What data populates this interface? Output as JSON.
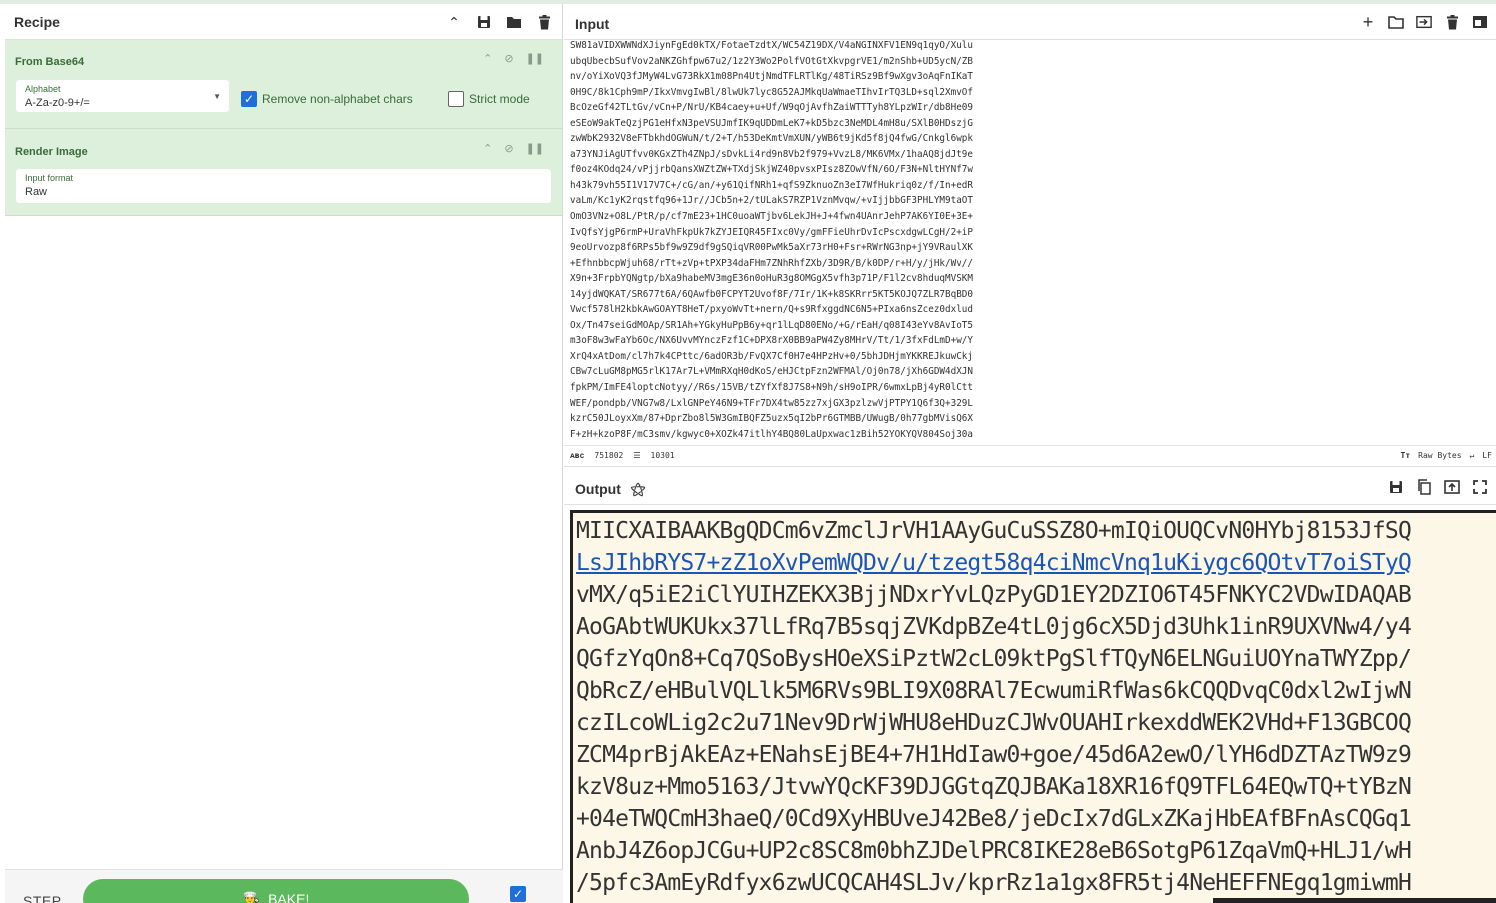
{
  "recipe": {
    "title": "Recipe",
    "ops": [
      {
        "name": "From Base64",
        "alphabet_label": "Alphabet",
        "alphabet_value": "A-Za-z0-9+/=",
        "remove_nonalpha_label": "Remove non-alphabet chars",
        "remove_nonalpha_checked": true,
        "strict_label": "Strict mode",
        "strict_checked": false
      },
      {
        "name": "Render Image",
        "input_format_label": "Input format",
        "input_format_value": "Raw"
      }
    ],
    "footer": {
      "step_label": "STEP",
      "bake_label": "BAKE!",
      "auto_bake_checked": true
    }
  },
  "input": {
    "title": "Input",
    "lines": [
      "SW81aVIDXWWNdXJiynFgEd0kTX/FotaeTzdtX/WC54Z19DX/V4aNGINXFV1EN9q1qyO/Xulu",
      "ubqUbecbSufVov2aNKZGhfpw67u2/1z2Y3Wo2PolfVOtGtXkvpgrVE1/m2nShb+UD5ycN/ZB",
      "nv/oYiXoVQ3fJMyW4LvG73RkX1m08Pn4UtjNmdTFLRTlKg/48TiRSz9Bf9wXgv3oAqFnIKaT",
      "0H9C/8k1Cph9mP/IkxVmvgIwBl/8lwUk7lyc8G52AJMkqUaWmaeTIhvIrTQ3LD+sql2XmvOf",
      "BcOzeGf42TLtGv/vCn+P/NrU/KB4caey+u+Uf/W9qOjAvfhZaiWTTTyh8YLpzWIr/db8He09",
      "eSEoW9akTeQzjPG1eHfxN3peVSUJmfIK9qUDDmLeK7+kD5bzc3NeMDL4mH8u/SXlB0HDszjG",
      "zwWbK2932V8eFTbkhdOGWuN/t/2+T/h53DeKmtVmXUN/yWB6t9jKd5f8jQ4fwG/Cnkgl6wpk",
      "a73YNJiAgUTfvv0KGxZTh4ZNpJ/sDvkLi4rd9n8Vb2f979+VvzL8/MK6VMx/1haAQ8jdJt9e",
      "f0oz4KOdq24/vPjjrbQansXWZtZW+TXdjSkjWZ40pvsxPIsz8ZOwVfN/6O/F3N+NltHYNf7w",
      "h43k79vh55I1V17V7C+/cG/an/+y61QifNRh1+qfS9ZknuoZn3eI7WfHukriq0z/f/In+edR",
      "vaLm/Kc1yK2rqstfq96+1Jr//JCb5n+2/tULakS7RZP1VznMvqw/+vIjjbbGF3PHLYM9taOT",
      "OmO3VNz+O8L/PtR/p/cf7mE23+1HC0uoaWTjbv6LekJH+J+4fwn4UAnrJehP7AK6YI0E+3E+",
      "IvQfsYjgP6rmP+UraVhFkpUk7kZYJEIQR45FIxc0Vy/gmFFieUhrDvIcPscxdgwLCgH/2+iP",
      "9eoUrvozp8f6RPs5bf9w9Z9df9gSQiqVR00PwMk5aXr73rH0+Fsr+RWrNG3np+jY9VRaulXK",
      "+EfhnbbcpWjuh68/rTt+zVp+tPXP34daFHm7ZNhRhfZXb/3D9R/B/k0DP/r+H/y/jHk/Wv//",
      "X9n+3FrpbYQNgtp/bXa9habeMV3mgE36n0oHuR3g8OMGgX5vfh3p71P/F1l2cv8hduqMVSKM",
      "14yjdWQKAT/SR677t6A/6QAwfb0FCPYT2Uvof8F/7Ir/1K+k8SKRrr5KT5KOJQ7ZLR7BqBD0",
      "Vwcf578lH2kbkAwGOAYT8HeT/pxyoWvTt+nern/Q+s9RfxggdNC6N5+PIxa6nsZcez0dxlud",
      "Ox/Tn47seiGdMOAp/SR1Ah+YGkyHuPpB6y+qr1lLqD80ENo/+G/rEaH/q08I43eYv8AvIoT5",
      "m3oF8w3wFaYb6Oc/NX6UvvMYnczFzf1C+DPX8rX0BB9aPW4Zy8MHrV/Tt/1/3fxFdLmD+w/Y",
      "XrQ4xAtDom/cl7h7k4CPttc/6adOR3b/FvQX7Cf0H7e4HPzHv+0/5bhJDHjmYKKREJkuwCkj",
      "CBw7cLuGM8pMG5rlK17Ar7L+VMmRXqH0dKoS/eHJCtpFzn2WFMAl/Oj0n78/jXh6GDW4dXJN",
      "fpkPM/ImFE4loptcNotyy//R6s/15VB/tZYfXf8J7S8+N9h/sH9oIPR/6wmxLpBj4yR0lCtt",
      "WEF/pondpb/VNG7w8/LxlGNPeY46N9+TFr7DX4tw85zz7xjGX3pzlzwVjPTPY1Q6f3Q+329L",
      "kzrC50JLoyxXm/87+DprZbo8l5W3GmIBQFZ5uzx5qI2bPr6GTMBB/UWugB/0h77gbMVisQ6X",
      "F+zH+kzoP8F/mC3smv/kgwyc0+XOZk47itlhY4BQ80LaUpxwac1zBih52YOKYQV804Soj30a"
    ],
    "status": {
      "length_icon": "abc-icon",
      "length": "751802",
      "lines_count": "10301",
      "encoding": "Raw Bytes",
      "eol": "LF"
    }
  },
  "output": {
    "title": "Output",
    "lines": [
      "MIICXAIBAAKBgQDCm6vZmclJrVH1AAyGuCuSSZ8O+mIQiOUQCvN0HYbj8153JfSQ",
      "LsJIhbRYS7+zZ1oXvPemWQDv/u/tzegt58q4ciNmcVnq1uKiygc6QOtvT7oiSTyQ",
      "vMX/q5iE2iClYUIHZEKX3BjjNDxrYvLQzPyGD1EY2DZIO6T45FNKYC2VDwIDAQAB",
      "AoGAbtWUKUkx37lLfRq7B5sqjZVKdpBZe4tL0jg6cX5Djd3Uhk1inR9UXVNw4/y4",
      "QGfzYqOn8+Cq7QSoBysHOeXSiPztW2cL09ktPgSlfTQyN6ELNGuiUOYnaTWYZpp/",
      "QbRcZ/eHBulVQLlk5M6RVs9BLI9X08RAl7EcwumiRfWas6kCQQDvqC0dxl2wIjwN",
      "czILcoWLig2c2u71Nev9DrWjWHU8eHDuzCJWvOUAHIrkexddWEK2VHd+F13GBCOQ",
      "ZCM4prBjAkEAz+ENahsEjBE4+7H1HdIaw0+goe/45d6A2ewO/lYH6dDZTAzTW9z9",
      "kzV8uz+Mmo5163/JtvwYQcKF39DJGGtqZQJBAKa18XR16fQ9TFL64EQwTQ+tYBzN",
      "+04eTWQCmH3haeQ/0Cd9XyHBUveJ42Be8/jeDcIx7dGLxZKajHbEAfBFnAsCQGq1",
      "AnbJ4Z6opJCGu+UP2c8SC8m0bhZJDelPRC8IKE28eB6SotgP61ZqaVmQ+HLJ1/wH",
      "/5pfc3AmEyRdfyx6zwUCQCAH4SLJv/kprRz1a1gx8FR5tj4NeHEFFNEgq1gmiwmH"
    ],
    "link_line_index": 1
  },
  "colors": {
    "op_background": "#dcf0dc",
    "bake_green": "#5cb85c",
    "checkbox_blue": "#1e6fd9",
    "output_background": "#fdf7e7",
    "link_blue": "#1a55b8"
  }
}
